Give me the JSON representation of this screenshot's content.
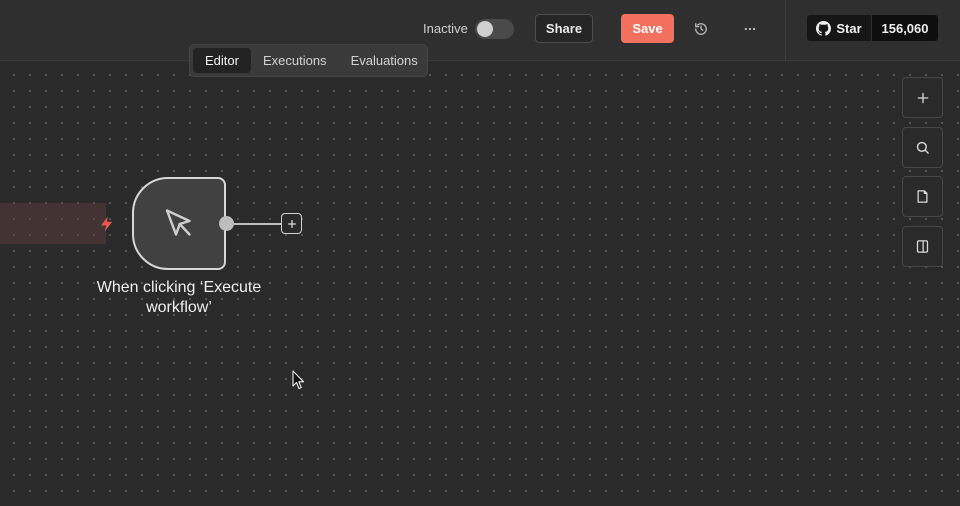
{
  "header": {
    "active_toggle": {
      "label": "Inactive",
      "on": false
    },
    "share_label": "Share",
    "save_label": "Save",
    "history_icon": "history-icon",
    "more_icon": "more-horizontal-icon",
    "github": {
      "star_label": "Star",
      "star_count": "156,060",
      "icon": "github-icon"
    }
  },
  "tabs": [
    {
      "label": "Editor",
      "active": true
    },
    {
      "label": "Executions",
      "active": false
    },
    {
      "label": "Evaluations",
      "active": false
    }
  ],
  "canvas_controls": [
    {
      "icon": "plus-icon",
      "label": "Add node"
    },
    {
      "icon": "search-icon",
      "label": "Search"
    },
    {
      "icon": "sticky-note-icon",
      "label": "Add sticky note"
    },
    {
      "icon": "panel-icon",
      "label": "Toggle panel"
    }
  ],
  "workflow": {
    "nodes": [
      {
        "name": "When clicking ‘Execute workflow’",
        "icon": "mouse-pointer-icon",
        "trigger": true
      }
    ]
  },
  "colors": {
    "accent": "#f36f5e",
    "canvas_bg": "#2a2a2a",
    "node_border": "#d7d7d7"
  }
}
